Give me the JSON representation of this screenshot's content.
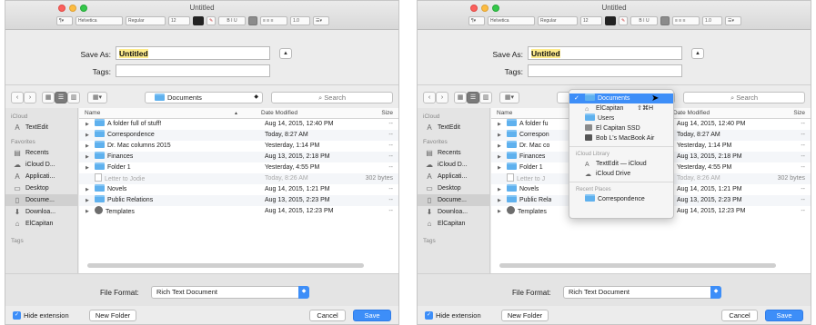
{
  "window": {
    "title": "Untitled",
    "format_bar": {
      "paragraph_style": "¶▾",
      "font": "Helvetica",
      "weight": "Regular",
      "size": "12",
      "bold": "B",
      "italic": "I",
      "underline": "U",
      "line_spacing": "1.0"
    }
  },
  "save": {
    "save_as_label": "Save As:",
    "filename": "Untitled",
    "tags_label": "Tags:",
    "tags_value": ""
  },
  "toolbar": {
    "location": "Documents",
    "search_placeholder": "Search"
  },
  "sidebar": {
    "sections": [
      {
        "heading": "iCloud",
        "items": [
          {
            "label": "TextEdit",
            "icon": "app-icon"
          }
        ]
      },
      {
        "heading": "Favorites",
        "items": [
          {
            "label": "Recents",
            "icon": "recents-icon"
          },
          {
            "label": "iCloud D...",
            "icon": "cloud-icon"
          },
          {
            "label": "Applicati...",
            "icon": "applications-icon"
          },
          {
            "label": "Desktop",
            "icon": "desktop-icon"
          },
          {
            "label": "Docume...",
            "icon": "documents-icon",
            "active": true
          },
          {
            "label": "Downloa...",
            "icon": "download-icon"
          },
          {
            "label": "ElCapitan",
            "icon": "home-icon"
          }
        ]
      },
      {
        "heading": "Tags",
        "items": []
      }
    ]
  },
  "file_list": {
    "columns": {
      "name": "Name",
      "date": "Date Modified",
      "size": "Size"
    },
    "rows": [
      {
        "name": "A folder full of stuff!",
        "date": "Aug 14, 2015, 12:40 PM",
        "size": "--",
        "kind": "folder"
      },
      {
        "name": "Correspondence",
        "date": "Today, 8:27 AM",
        "size": "--",
        "kind": "folder"
      },
      {
        "name": "Dr. Mac columns 2015",
        "date": "Yesterday, 1:14 PM",
        "size": "--",
        "kind": "folder"
      },
      {
        "name": "Finances",
        "date": "Aug 13, 2015, 2:18 PM",
        "size": "--",
        "kind": "folder"
      },
      {
        "name": "Folder 1",
        "date": "Yesterday, 4:55 PM",
        "size": "--",
        "kind": "folder"
      },
      {
        "name": "Letter to Jodie",
        "date": "Today, 8:26 AM",
        "size": "302 bytes",
        "kind": "doc",
        "dim": true
      },
      {
        "name": "Novels",
        "date": "Aug 14, 2015, 1:21 PM",
        "size": "--",
        "kind": "folder"
      },
      {
        "name": "Public Relations",
        "date": "Aug 13, 2015, 2:23 PM",
        "size": "--",
        "kind": "folder"
      },
      {
        "name": "Templates",
        "date": "Aug 14, 2015, 12:23 PM",
        "size": "--",
        "kind": "template"
      }
    ],
    "right_dates": [
      "Aug 14, 2015, 12:40 PM",
      "Today, 8:27 AM",
      "Yesterday, 1:14 PM",
      "Aug 13, 2015, 2:18 PM",
      "Yesterday, 4:55 PM",
      "Today, 8:26 AM",
      "Aug 14, 2015, 1:21 PM",
      "Aug 13, 2015, 2:23 PM",
      "Aug 14, 2015, 12:23 PM"
    ],
    "right_names": [
      "A folder fu",
      "Correspon",
      "Dr. Mac co",
      "Finances",
      "Folder 1",
      "Letter to J",
      "Novels",
      "Public Rela",
      "Templates"
    ]
  },
  "format": {
    "label": "File Format:",
    "value": "Rich Text Document"
  },
  "bottom": {
    "hide_extension_label": "Hide extension",
    "hide_extension_checked": true,
    "new_folder_label": "New Folder",
    "cancel_label": "Cancel",
    "save_label": "Save"
  },
  "location_menu": {
    "selected": "Documents",
    "items": [
      {
        "label": "ElCapitan",
        "shortcut": "⇧⌘H",
        "icon": "home-icon"
      },
      {
        "label": "Users",
        "icon": "folder-icon"
      },
      {
        "label": "El Capitan SSD",
        "icon": "drive-icon"
      },
      {
        "label": "Bob L's MacBook Air",
        "icon": "computer-icon"
      }
    ],
    "icloud_heading": "iCloud Library",
    "icloud_items": [
      {
        "label": "TextEdit — iCloud",
        "icon": "app-icon"
      },
      {
        "label": "iCloud Drive",
        "icon": "cloud-icon"
      }
    ],
    "recent_heading": "Recent Places",
    "recent_items": [
      {
        "label": "Correspondence",
        "icon": "folder-icon"
      }
    ]
  },
  "colors": {
    "accent": "#3d8ef8",
    "folder": "#5fb1ee",
    "highlight": "#fdeb8b"
  }
}
